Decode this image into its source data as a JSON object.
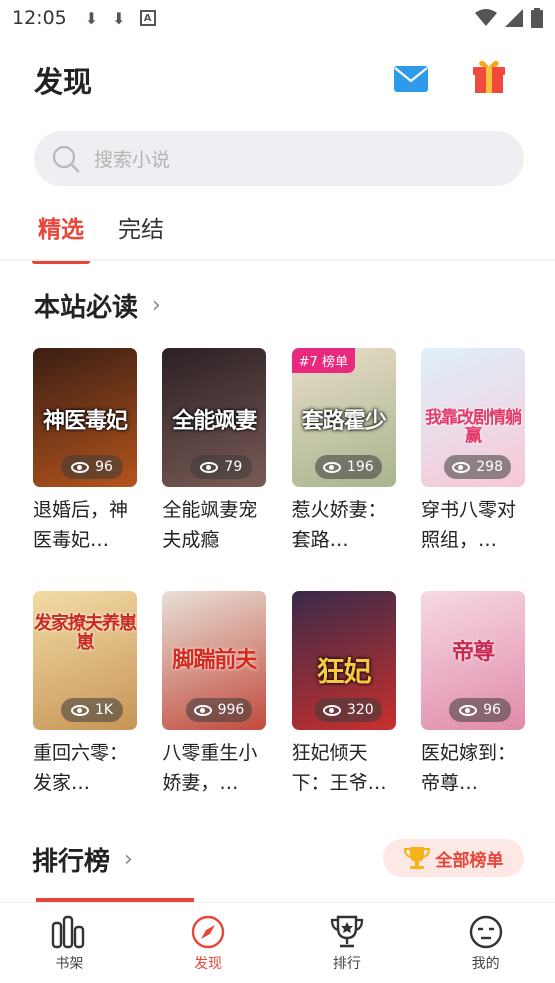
{
  "status": {
    "time": "12:05"
  },
  "header": {
    "title": "发现"
  },
  "search": {
    "placeholder": "搜索小说"
  },
  "tabs": [
    {
      "label": "精选",
      "active": true
    },
    {
      "label": "完结",
      "active": false
    }
  ],
  "section_must_read": {
    "title": "本站必读"
  },
  "books": [
    {
      "name": "退婚后，神医毒妃…",
      "views": "96",
      "cover_text": "神医毒妃",
      "colors": [
        "#3a1e14",
        "#b5541c"
      ]
    },
    {
      "name": "全能飒妻宠夫成瘾",
      "views": "79",
      "cover_text": "全能飒妻",
      "colors": [
        "#2b2024",
        "#7a5b56"
      ]
    },
    {
      "name": "惹火娇妻：套路…",
      "views": "196",
      "cover_text": "套路霍少",
      "badge": "#7 榜单",
      "colors": [
        "#e9dcc8",
        "#a7b58e"
      ]
    },
    {
      "name": "穿书八零对照组，…",
      "views": "298",
      "cover_text": "我靠改剧情躺赢",
      "colors": [
        "#dff0fb",
        "#f7c7d6"
      ]
    },
    {
      "name": "重回六零：发家…",
      "views": "1K",
      "cover_text": "发家撩夫养崽崽",
      "colors": [
        "#f2dca6",
        "#c79456"
      ]
    },
    {
      "name": "八零重生小娇妻，…",
      "views": "996",
      "cover_text": "脚踹前夫",
      "colors": [
        "#e8e0d6",
        "#c24a3d"
      ]
    },
    {
      "name": "狂妃倾天下：王爷…",
      "views": "320",
      "cover_text": "狂妃",
      "colors": [
        "#3a2a4a",
        "#c8302c"
      ]
    },
    {
      "name": "医妃嫁到：帝尊…",
      "views": "96",
      "cover_text": "帝尊",
      "colors": [
        "#f7d9e6",
        "#e08aa8"
      ]
    }
  ],
  "section_ranking": {
    "title": "排行榜",
    "all_label": "全部榜单"
  },
  "bottom_nav": [
    {
      "label": "书架",
      "icon": "bookshelf-icon",
      "active": false
    },
    {
      "label": "发现",
      "icon": "compass-icon",
      "active": true
    },
    {
      "label": "排行",
      "icon": "trophy-icon",
      "active": false
    },
    {
      "label": "我的",
      "icon": "face-icon",
      "active": false
    }
  ],
  "colors": {
    "accent": "#e9463a",
    "badge": "#e9287f",
    "search_bg": "#eeeff2"
  }
}
